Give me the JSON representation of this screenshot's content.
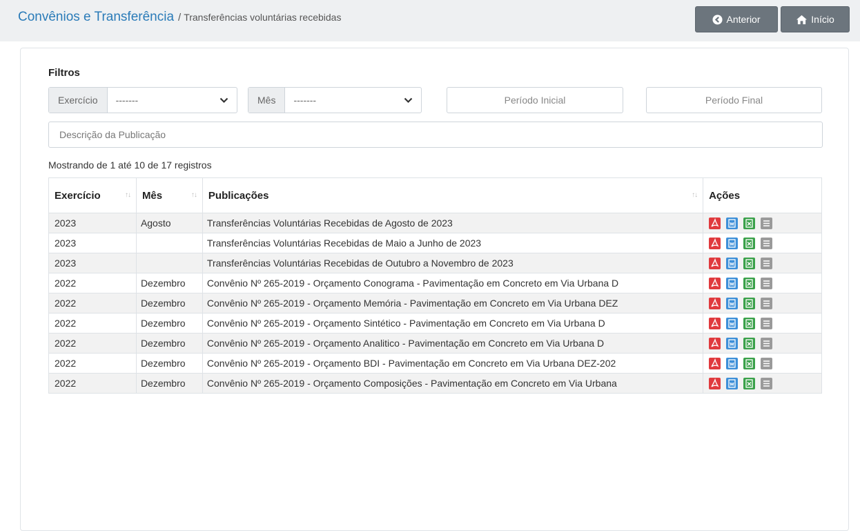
{
  "breadcrumb": {
    "section": "Convênios e Transferência",
    "separator": "/",
    "current": "Transferências voluntárias recebidas"
  },
  "nav": {
    "prev_label": "Anterior",
    "home_label": "Início"
  },
  "filters": {
    "title": "Filtros",
    "exercicio_label": "Exercício",
    "exercicio_value": "-------",
    "mes_label": "Mês",
    "mes_value": "-------",
    "periodo_inicial_placeholder": "Período Inicial",
    "periodo_final_placeholder": "Período Final",
    "descricao_placeholder": "Descrição da Publicação"
  },
  "table": {
    "info": "Mostrando de 1 até 10 de 17 registros",
    "columns": [
      "Exercício",
      "Mês",
      "Publicações",
      "Ações"
    ],
    "rows": [
      {
        "exercicio": "2023",
        "mes": "Agosto",
        "publicacao": "Transferências Voluntárias Recebidas de Agosto de 2023"
      },
      {
        "exercicio": "2023",
        "mes": "",
        "publicacao": "Transferências Voluntárias Recebidas de Maio a Junho de 2023"
      },
      {
        "exercicio": "2023",
        "mes": "",
        "publicacao": "Transferências Voluntárias Recebidas de Outubro a Novembro de 2023"
      },
      {
        "exercicio": "2022",
        "mes": "Dezembro",
        "publicacao": "Convênio Nº 265-2019 - Orçamento Conograma - Pavimentação em Concreto em Via Urbana D"
      },
      {
        "exercicio": "2022",
        "mes": "Dezembro",
        "publicacao": "Convênio Nº 265-2019 - Orçamento Memória - Pavimentação em Concreto em Via Urbana DEZ"
      },
      {
        "exercicio": "2022",
        "mes": "Dezembro",
        "publicacao": "Convênio Nº 265-2019 - Orçamento Sintético - Pavimentação em Concreto em Via Urbana D"
      },
      {
        "exercicio": "2022",
        "mes": "Dezembro",
        "publicacao": "Convênio Nº 265-2019 - Orçamento Analitico - Pavimentação em Concreto em Via Urbana D"
      },
      {
        "exercicio": "2022",
        "mes": "Dezembro",
        "publicacao": "Convênio Nº 265-2019 - Orçamento BDI - Pavimentação em Concreto em Via Urbana DEZ-202"
      },
      {
        "exercicio": "2022",
        "mes": "Dezembro",
        "publicacao": "Convênio Nº 265-2019 - Orçamento Composições - Pavimentação em Concreto em Via Urbana"
      }
    ],
    "actions": [
      "pdf-icon",
      "doc-icon",
      "excel-icon",
      "details-icon"
    ]
  },
  "colors": {
    "link": "#2a7bb8",
    "button": "#6c757d",
    "pdf": "#e03a3e",
    "doc": "#3d8fd8",
    "excel": "#3aa14a",
    "details": "#9a9a9a"
  }
}
